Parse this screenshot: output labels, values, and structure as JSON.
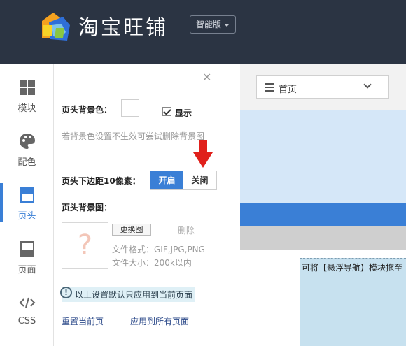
{
  "header": {
    "brand": "淘宝旺铺",
    "edition": "智能版"
  },
  "sidebar": {
    "items": [
      {
        "label": "模块",
        "icon": "grid-icon"
      },
      {
        "label": "配色",
        "icon": "palette-icon"
      },
      {
        "label": "页头",
        "icon": "header-layout-icon",
        "active": true
      },
      {
        "label": "页面",
        "icon": "page-layout-icon"
      },
      {
        "label": "CSS",
        "icon": "code-icon"
      }
    ]
  },
  "panel": {
    "bg_color_label": "页头背景色：",
    "show_label": "显示",
    "show_checked": true,
    "hint": "若背景色设置不生效可尝试删除背景图",
    "margin_label": "页头下边距10像素：",
    "toggle_on": "开启",
    "toggle_off": "关闭",
    "toggle_state": "开启",
    "bg_image_label": "页头背景图：",
    "replace_button": "更换图",
    "delete_link": "删除",
    "file_format": "文件格式：GIF,JPG,PNG",
    "file_size": "文件大小：200k以内",
    "notice": "以上设置默认只应用到当前页面",
    "reset_link": "重置当前页",
    "apply_all_link": "应用到所有页面"
  },
  "preview": {
    "page_select": "首页",
    "drop_text": "可将【悬浮导航】模块拖至"
  },
  "colors": {
    "topbar": "#2b3443",
    "accent": "#3a7fd6",
    "arrow": "#e0201b"
  }
}
